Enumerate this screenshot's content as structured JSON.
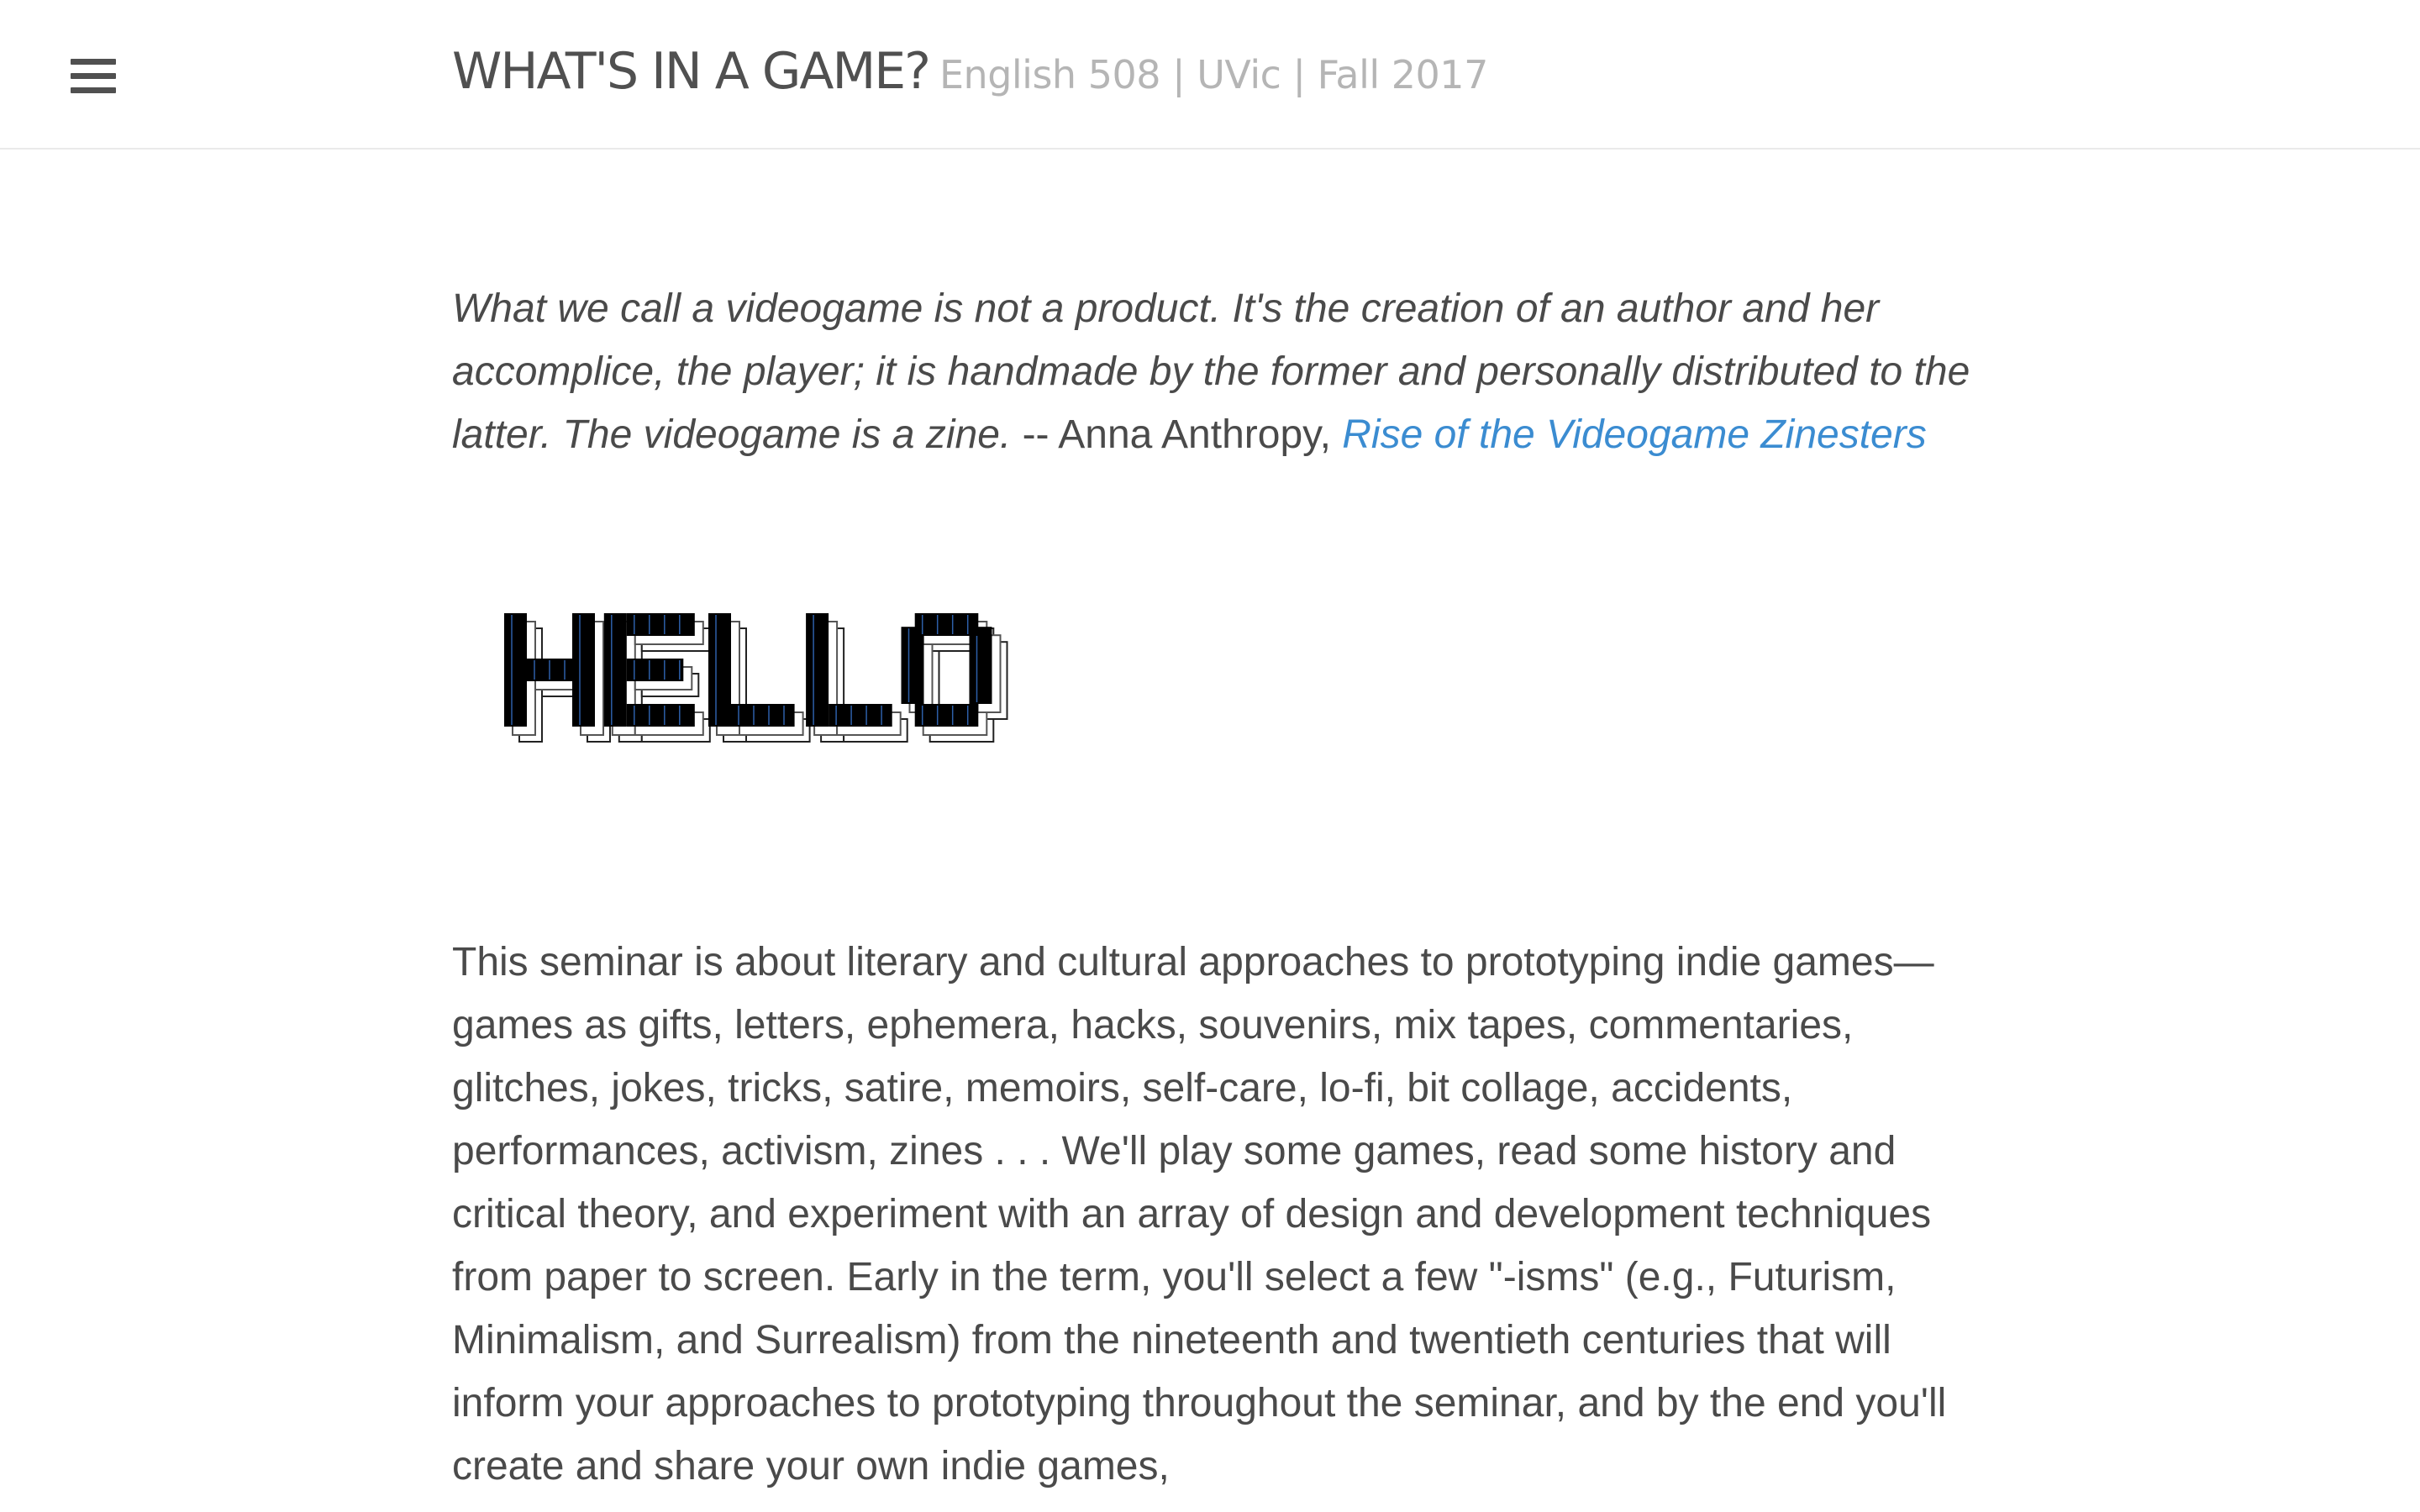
{
  "header": {
    "menu_icon": "hamburger-menu-icon",
    "title": "WHAT'S IN A GAME?",
    "tagline": "English 508 | UVic | Fall 2017"
  },
  "epigraph": {
    "quote": "What we call a videogame is not a product. It's the creation of an author and her accomplice, the player; it is handmade by the former and personally distributed to the latter. The videogame is a zine.",
    "attribution": " -- Anna Anthropy, ",
    "source_link": "Rise of the Videogame Zinesters"
  },
  "hello_image": {
    "word": "HELLO"
  },
  "intro": {
    "text": "This seminar is about literary and cultural approaches to prototyping indie games—games as gifts, letters, ephemera, hacks, souvenirs, mix tapes, commentaries, glitches, jokes, tricks, satire, memoirs, self-care, lo-fi, bit collage, accidents, performances, activism, zines . . . We'll play some games, read some history and critical theory, and experiment with an array of design and development techniques from paper to screen. Early in the term, you'll select a few \"-isms\" (e.g., Futurism, Minimalism, and Surrealism) from the nineteenth and twentieth centuries that will inform your approaches to prototyping throughout the seminar, and by the end you'll create and share your own indie games,"
  },
  "colors": {
    "link": "#3b8cd1",
    "text": "#4a4a4a",
    "title": "#505050",
    "tagline": "#b5b5b5",
    "hello_fill": "#000000",
    "hello_stripe": "#2d5fa8"
  }
}
